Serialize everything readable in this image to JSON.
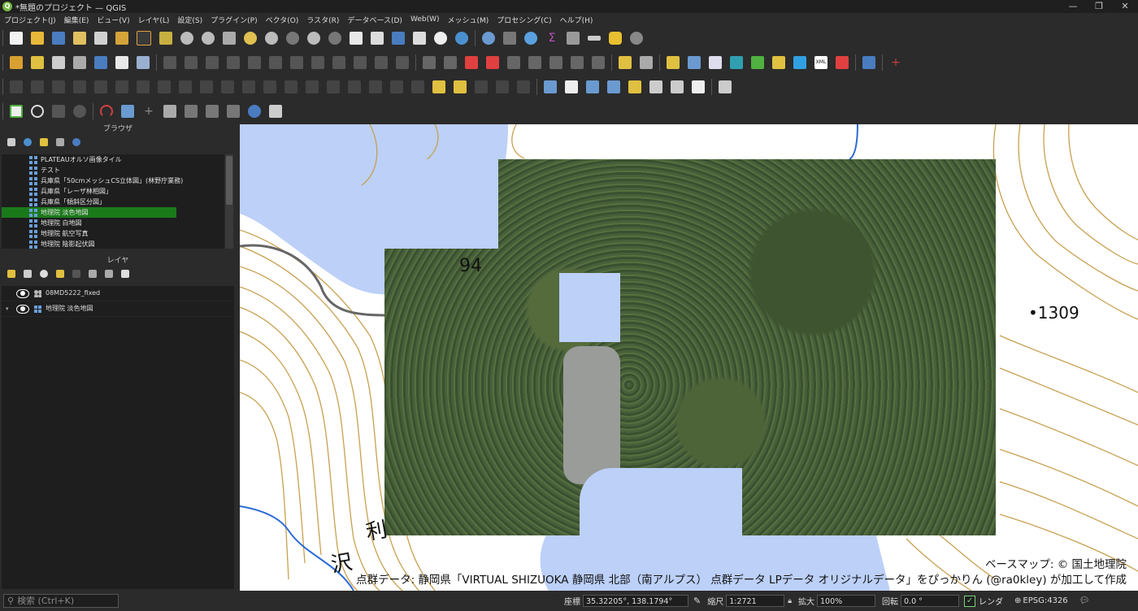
{
  "window": {
    "title": "*無題のプロジェクト — QGIS",
    "controls": [
      "—",
      "❐",
      "✕"
    ]
  },
  "menu": [
    "プロジェクト(J)",
    "編集(E)",
    "ビュー(V)",
    "レイヤ(L)",
    "設定(S)",
    "プラグイン(P)",
    "ベクタ(O)",
    "ラスタ(R)",
    "データベース(D)",
    "Web(W)",
    "メッシュ(M)",
    "プロセシング(C)",
    "ヘルプ(H)"
  ],
  "browser": {
    "title": "ブラウザ",
    "items": [
      "PLATEAUオルソ画像タイル",
      "テスト",
      "兵庫県「50cmメッシュCS立体図」(林野庁業務)",
      "兵庫県「レーザ林相図」",
      "兵庫県「傾斜区分図」",
      "地理院 淡色地図",
      "地理院 白地図",
      "地理院 航空写真",
      "地理院 陰影起伏図"
    ],
    "selected_index": 5
  },
  "layers": {
    "title": "レイヤ",
    "items": [
      {
        "name": "08MD5222_fixed",
        "icon": "point-cloud-icon"
      },
      {
        "name": "地理院 淡色地図",
        "icon": "xyz-tile-icon"
      }
    ]
  },
  "map": {
    "labels": [
      "94",
      "•1309",
      "利",
      "沢"
    ],
    "attribution_line1": "ベースマップ: © 国土地理院",
    "attribution_line2": "点群データ: 静岡県「VIRTUAL SHIZUOKA 静岡県 北部（南アルプス） 点群データ LPデータ オリジナルデータ」をぴっかりん (@ra0kley) が加工して作成",
    "colors": {
      "water": "#bcd0f8",
      "contour": "#c8a050",
      "forest": "#4b6337"
    }
  },
  "status": {
    "search_placeholder": "検索 (Ctrl+K)",
    "coord_label": "座標",
    "coord_value": "35.32205°, 138.1794°",
    "scale_label": "縮尺",
    "scale_value": "1:2721",
    "zoom_label": "拡大",
    "zoom_value": "100%",
    "rotation_label": "回転",
    "rotation_value": "0.0 °",
    "render_label": "レンダ",
    "crs": "EPSG:4326"
  }
}
